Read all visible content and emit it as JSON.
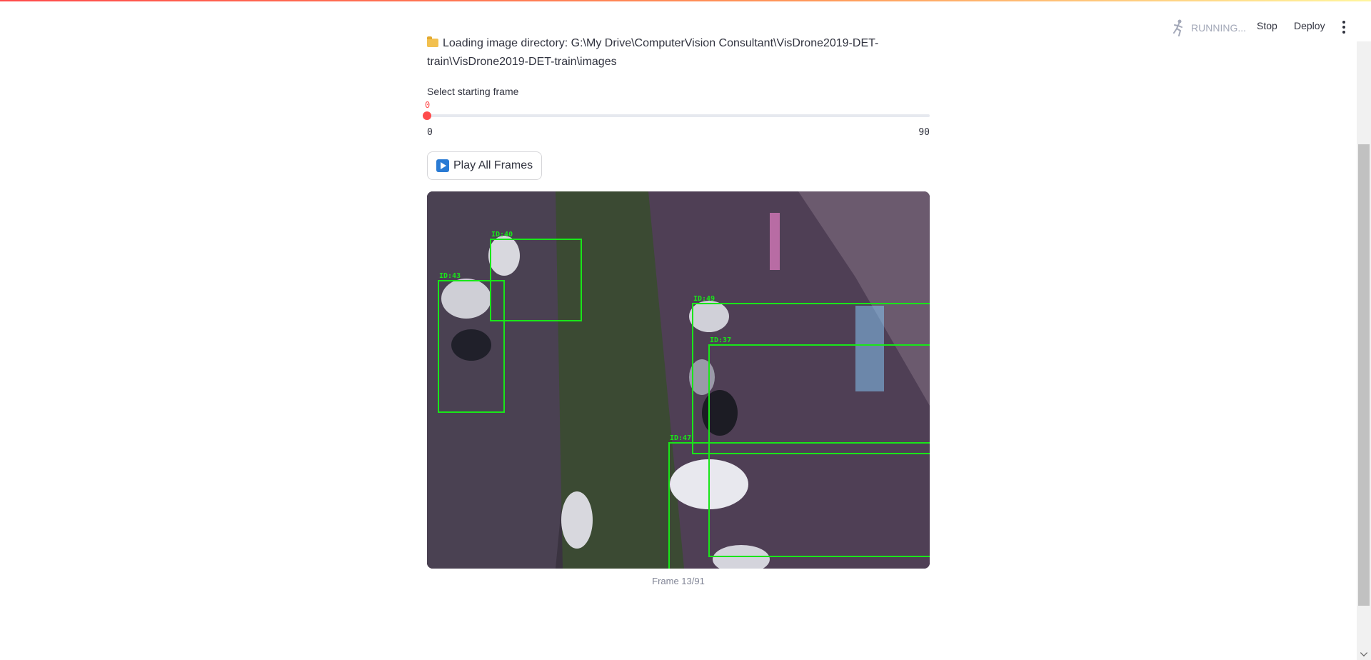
{
  "header": {
    "status": "RUNNING...",
    "stop": "Stop",
    "deploy": "Deploy",
    "status_icon": "running-man-icon",
    "menu_icon": "more-vert-icon"
  },
  "main": {
    "loading_text": "Loading image directory: G:\\My Drive\\ComputerVision Consultant\\VisDrone2019-DET-train\\VisDrone2019-DET-train\\images",
    "slider": {
      "label": "Select starting frame",
      "current_value": "0",
      "min": "0",
      "max": "90",
      "level": 0
    },
    "play_button": "Play All Frames",
    "frame": {
      "caption": "Frame 13/91",
      "detections": [
        {
          "id": "ID:40"
        },
        {
          "id": "ID:43"
        },
        {
          "id": "ID:49"
        },
        {
          "id": "ID:37"
        },
        {
          "id": "ID:47"
        }
      ]
    }
  },
  "colors": {
    "accent": "#ff4b4b",
    "detection": "#19e619",
    "button_icon": "#2a7bd4"
  }
}
